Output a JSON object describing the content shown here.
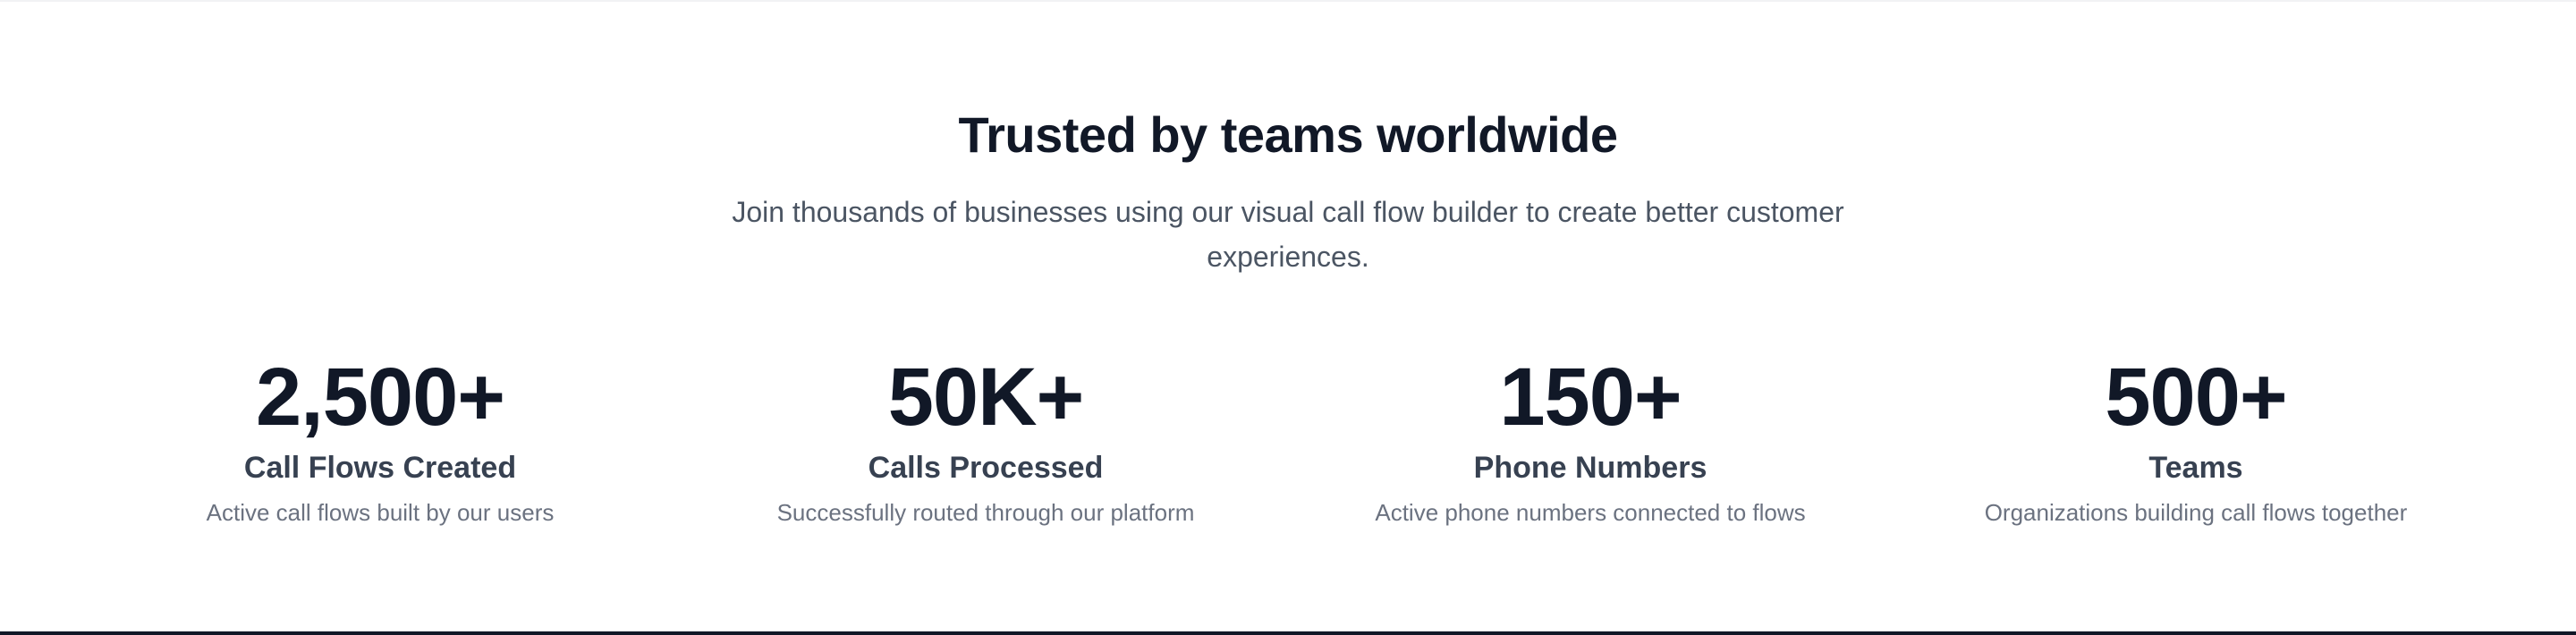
{
  "section": {
    "heading": "Trusted by teams worldwide",
    "subheading": "Join thousands of businesses using our visual call flow builder to create better customer experiences."
  },
  "stats": [
    {
      "value": "2,500+",
      "label": "Call Flows Created",
      "description": "Active call flows built by our users"
    },
    {
      "value": "50K+",
      "label": "Calls Processed",
      "description": "Successfully routed through our platform"
    },
    {
      "value": "150+",
      "label": "Phone Numbers",
      "description": "Active phone numbers connected to flows"
    },
    {
      "value": "500+",
      "label": "Teams",
      "description": "Organizations building call flows together"
    }
  ],
  "colors": {
    "heading": "#111827",
    "body_text": "#4b5563",
    "label": "#374151",
    "muted": "#6b7280",
    "background": "#ffffff"
  }
}
